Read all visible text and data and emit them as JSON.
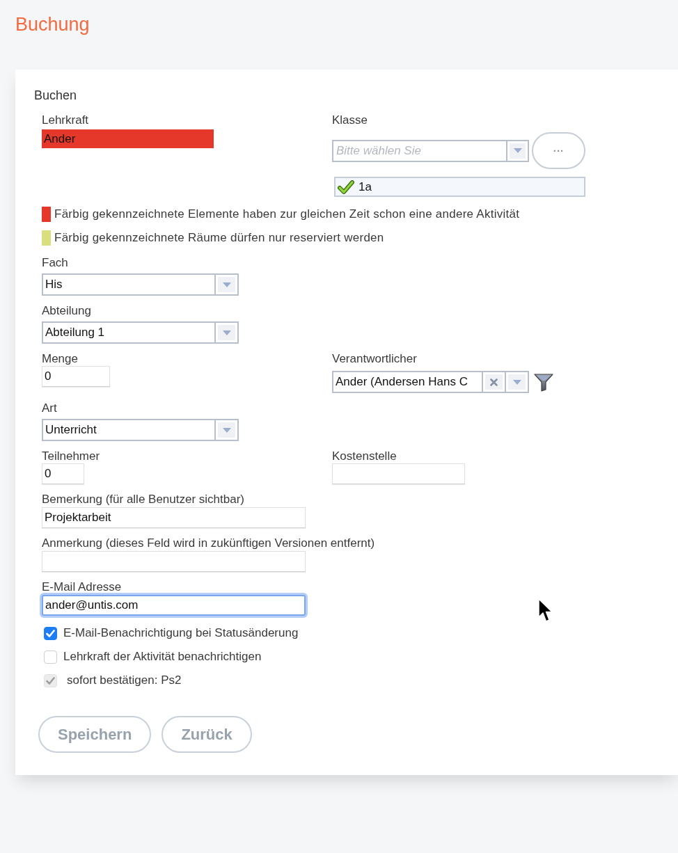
{
  "page": {
    "title": "Buchung"
  },
  "form": {
    "title": "Buchen",
    "teacher": {
      "label": "Lehrkraft",
      "value": "Ander",
      "conflict": true
    },
    "class": {
      "label": "Klasse",
      "placeholder": "Bitte wählen Sie",
      "more_button": "...",
      "chosen": [
        {
          "label": "1a",
          "checked": true
        }
      ]
    },
    "legend": [
      {
        "color": "#e5372a",
        "text": "Färbig gekennzeichnete Elemente haben zur gleichen Zeit schon eine andere Aktivität"
      },
      {
        "color": "#d9df7e",
        "text": "Färbig gekennzeichnete Räume dürfen nur reserviert werden"
      }
    ],
    "subject": {
      "label": "Fach",
      "value": "His"
    },
    "department": {
      "label": "Abteilung",
      "value": "Abteilung 1"
    },
    "quantity": {
      "label": "Menge",
      "value": "0"
    },
    "responsible": {
      "label": "Verantwortlicher",
      "value": "Ander (Andersen Hans C"
    },
    "type": {
      "label": "Art",
      "value": "Unterricht"
    },
    "participants": {
      "label": "Teilnehmer",
      "value": "0"
    },
    "cost_center": {
      "label": "Kostenstelle"
    },
    "remark": {
      "label": "Bemerkung (für alle Benutzer sichtbar)",
      "value": "Projektarbeit"
    },
    "note": {
      "label": "Anmerkung (dieses Feld wird in zukünftigen Versionen entfernt)"
    },
    "email": {
      "label": "E-Mail Adresse",
      "value": "ander@untis.com",
      "focused": true
    },
    "options": [
      {
        "label": "E-Mail-Benachrichtigung bei Statusänderung",
        "checked": true,
        "disabled": false
      },
      {
        "label": "Lehrkraft der Aktivität benachrichtigen",
        "checked": false,
        "disabled": false
      },
      {
        "label": "sofort bestätigen: Ps2",
        "checked": true,
        "disabled": true
      }
    ],
    "buttons": [
      {
        "label": "Speichern"
      },
      {
        "label": "Zurück"
      }
    ]
  }
}
